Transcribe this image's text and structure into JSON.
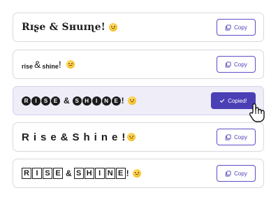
{
  "rows": [
    {
      "text_a": "Rɪʂe & Sнuɪɳe!",
      "button_label": "Copy"
    },
    {
      "text_small1": "rise",
      "text_amp": "&",
      "text_small2": "shine",
      "text_bang": "!",
      "button_label": "Copy"
    },
    {
      "letters1": [
        "R",
        "I",
        "S",
        "E"
      ],
      "amp": "&",
      "letters2": [
        "S",
        "H",
        "I",
        "N",
        "E"
      ],
      "bang": "!",
      "button_label": "Copied!"
    },
    {
      "text": "Rise&Shine!",
      "button_label": "Copy"
    },
    {
      "letters1": [
        "R",
        "I",
        "S",
        "E"
      ],
      "amp": "&",
      "letters2": [
        "S",
        "H",
        "I",
        "N",
        "E"
      ],
      "bang": "!",
      "button_label": "Copy"
    }
  ],
  "icons": {
    "copy": "copy-icon",
    "check": "check-icon",
    "emoji": "smiling-face-emoji",
    "cursor": "hand-pointer-cursor"
  },
  "colors": {
    "accent": "#4b3fb5",
    "selected_row_bg": "#eeedf8",
    "border": "#d9d9de",
    "text": "#1c1c1c"
  }
}
